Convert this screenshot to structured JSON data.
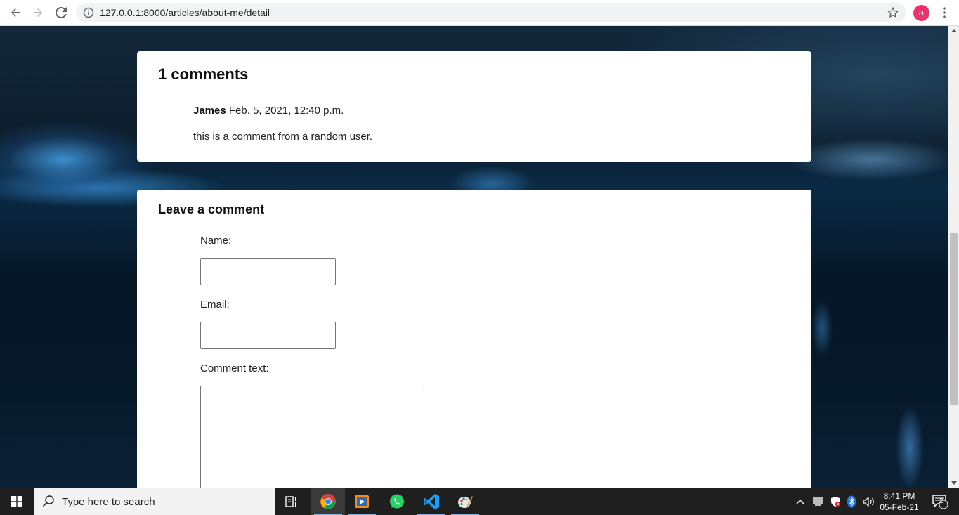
{
  "browser": {
    "url": "127.0.0.1:8000/articles/about-me/detail",
    "profile_initial": "a",
    "accent_color": "#e8336e"
  },
  "comments": {
    "heading": "1 comments",
    "items": [
      {
        "author": "James",
        "date": "Feb. 5, 2021, 12:40 p.m.",
        "text": "this is a comment from a random user."
      }
    ]
  },
  "form": {
    "heading": "Leave a comment",
    "name_label": "Name:",
    "name_value": "",
    "email_label": "Email:",
    "email_value": "",
    "comment_label": "Comment text:",
    "comment_value": ""
  },
  "taskbar": {
    "search_placeholder": "Type here to search",
    "apps": [
      "task-view-icon",
      "chrome-icon",
      "media-player-icon",
      "whatsapp-icon",
      "vscode-icon",
      "paint-icon"
    ],
    "time": "8:41 PM",
    "date": "05-Feb-21",
    "notification_count": "2"
  }
}
